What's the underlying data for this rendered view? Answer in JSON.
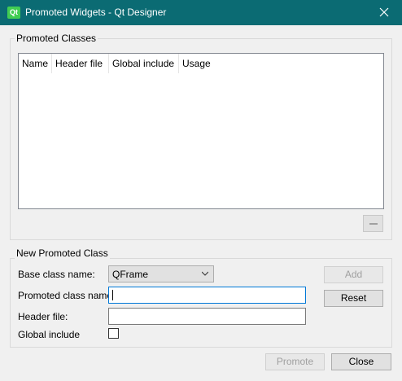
{
  "window": {
    "title": "Promoted Widgets - Qt Designer",
    "app_icon": "qt-logo-icon",
    "close_icon": "close-icon"
  },
  "promoted_classes": {
    "group_title": "Promoted Classes",
    "columns": [
      "Name",
      "Header file",
      "Global include",
      "Usage"
    ],
    "rows": [],
    "remove_icon": "minus-icon"
  },
  "new_promoted_class": {
    "group_title": "New Promoted Class",
    "base_class_label": "Base class name:",
    "base_class_value": "QFrame",
    "promoted_class_label": "Promoted class name:",
    "promoted_class_value": "",
    "header_file_label": "Header file:",
    "header_file_value": "",
    "global_include_label": "Global include",
    "global_include_checked": false,
    "add_label": "Add",
    "reset_label": "Reset"
  },
  "footer": {
    "promote_label": "Promote",
    "close_label": "Close"
  }
}
